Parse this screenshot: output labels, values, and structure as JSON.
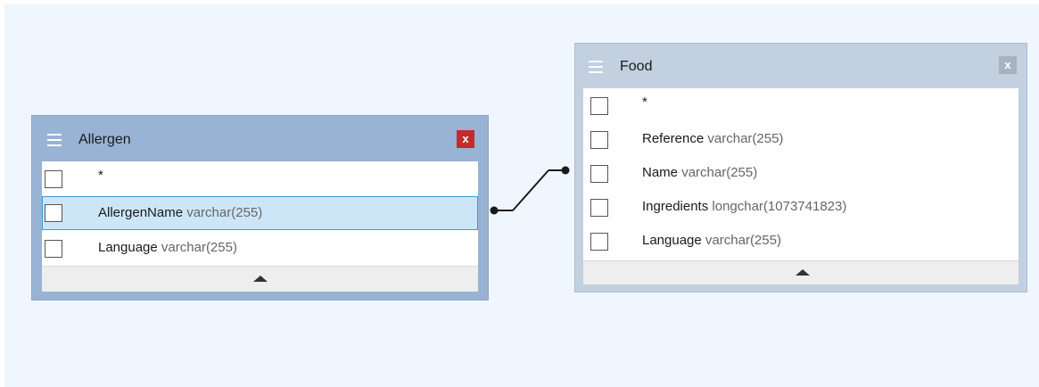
{
  "tables": {
    "allergen": {
      "title": "Allergen",
      "close_icon": "close-icon",
      "close_label": "x",
      "header_color": "#99b3d4",
      "close_color": "#c42b2b",
      "fields": [
        {
          "name": "*",
          "type": ""
        },
        {
          "name": "AllergenName",
          "type": "varchar(255)",
          "selected": true
        },
        {
          "name": "Language",
          "type": "varchar(255)"
        }
      ],
      "footer_icon": "collapse-up-icon"
    },
    "food": {
      "title": "Food",
      "close_icon": "close-icon",
      "close_label": "x",
      "header_color": "#c2d0df",
      "close_color": "#a9b3bf",
      "fields": [
        {
          "name": "*",
          "type": ""
        },
        {
          "name": "Reference",
          "type": "varchar(255)"
        },
        {
          "name": "Name",
          "type": "varchar(255)"
        },
        {
          "name": "Ingredients",
          "type": "longchar(1073741823)"
        },
        {
          "name": "Language",
          "type": "varchar(255)"
        }
      ],
      "footer_icon": "collapse-up-icon"
    }
  },
  "relationship": {
    "from": "Allergen.AllergenName",
    "to": "Food.Name"
  },
  "canvas_color": "#f0f6fd"
}
